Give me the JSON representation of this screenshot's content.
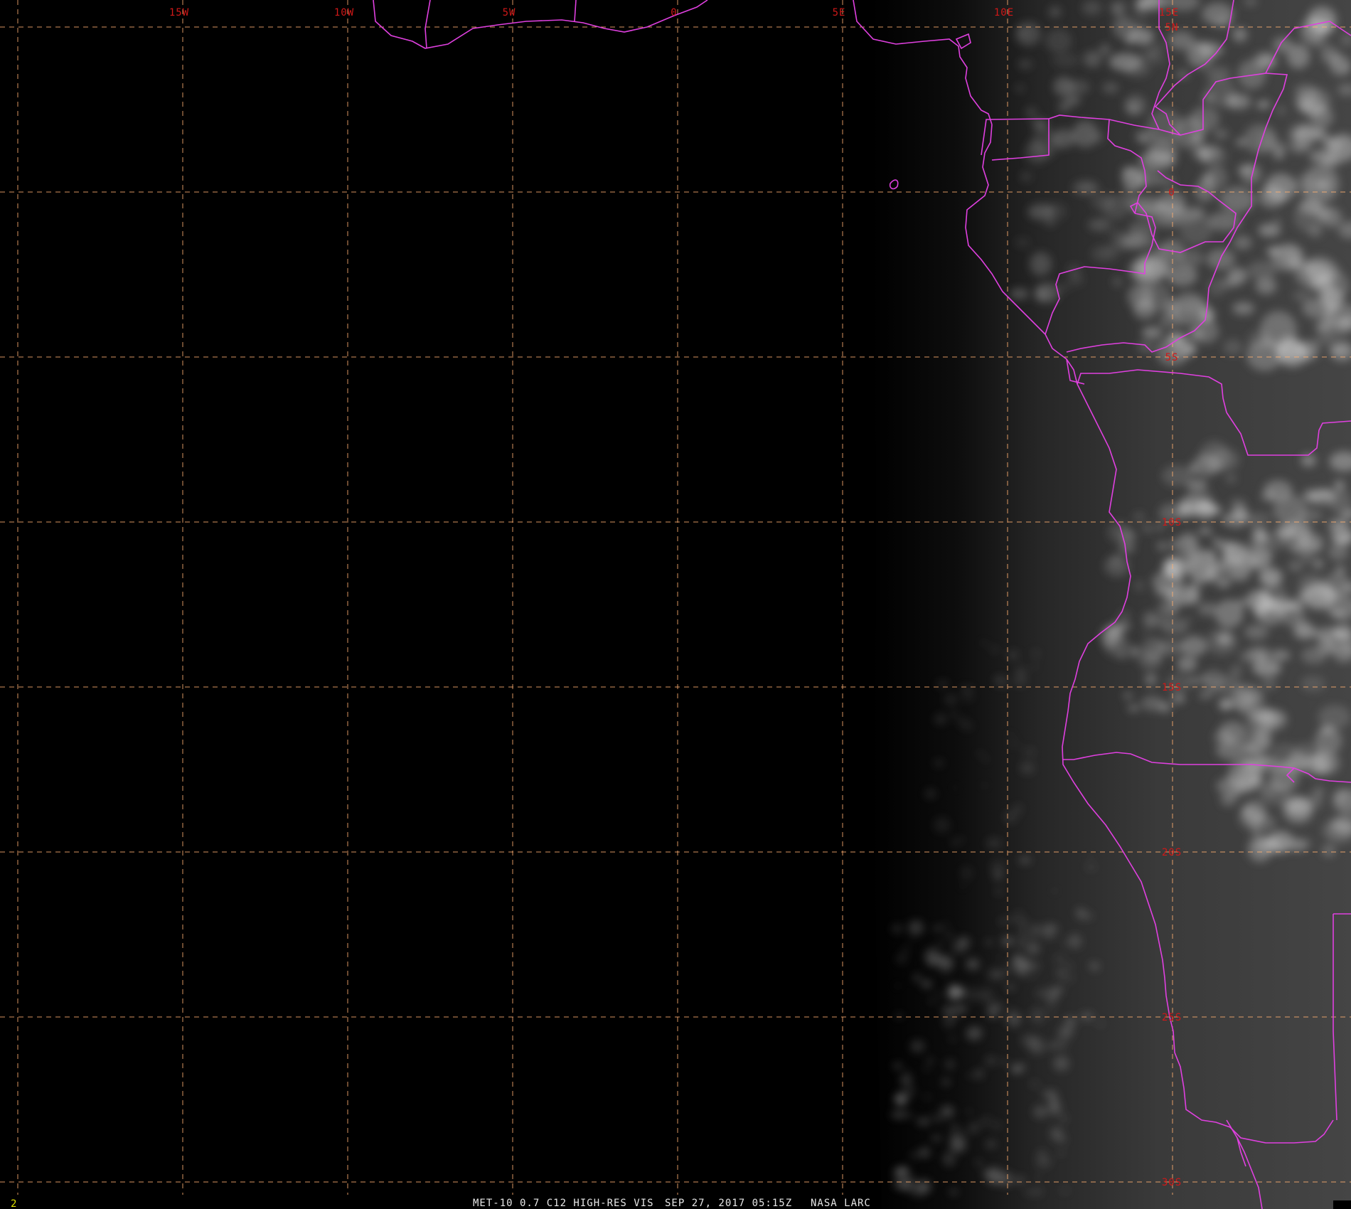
{
  "map": {
    "frame_number": "2",
    "caption": {
      "product": "MET-10 0.7 C12 HIGH-RES VIS",
      "datetime": "SEP 27, 2017 05:15Z",
      "source": "NASA LARC"
    },
    "longitude_labels": [
      "15W",
      "10W",
      "5W",
      "0",
      "5E",
      "10E",
      "15E"
    ],
    "latitude_labels": [
      "5N",
      "0",
      "5S",
      "10S",
      "15S",
      "20S",
      "25S",
      "30S"
    ],
    "colors": {
      "background": "#000000",
      "gridline": "#ffb070",
      "coast_border": "#e040e0",
      "grid_label": "#d01818",
      "frame_number": "#e0e000",
      "caption": "#e6e6e6",
      "cloud": "#d8d8d8"
    },
    "grid_style": "dashed",
    "projection": "equirectangular"
  }
}
